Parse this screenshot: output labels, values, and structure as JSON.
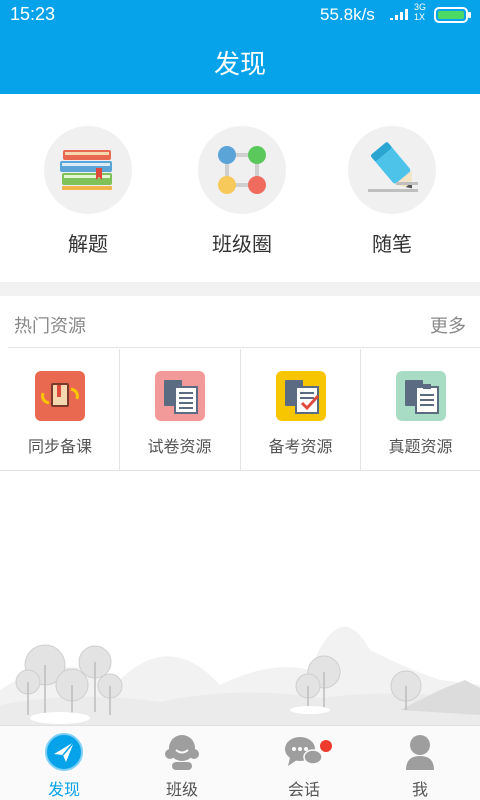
{
  "status_bar": {
    "time": "15:23",
    "net_speed": "55.8k/s",
    "network_top": "3G",
    "network_bottom": "1X",
    "battery_color": "#4cd964"
  },
  "header": {
    "title": "发现"
  },
  "quick_entries": [
    {
      "label": "解题",
      "icon": "books-icon"
    },
    {
      "label": "班级圈",
      "icon": "class-circle-icon"
    },
    {
      "label": "随笔",
      "icon": "pencil-note-icon"
    }
  ],
  "resources": {
    "title": "热门资源",
    "more_label": "更多",
    "items": [
      {
        "label": "同步备课",
        "icon": "sync-lesson-icon",
        "color": "#e8694f"
      },
      {
        "label": "试卷资源",
        "icon": "exam-paper-icon",
        "color": "#f29a9a"
      },
      {
        "label": "备考资源",
        "icon": "exam-prep-icon",
        "color": "#f7c600"
      },
      {
        "label": "真题资源",
        "icon": "real-exam-icon",
        "color": "#a8dcc5"
      }
    ]
  },
  "bottom_nav": [
    {
      "label": "发现",
      "icon": "discover-icon",
      "active": true
    },
    {
      "label": "班级",
      "icon": "class-icon",
      "active": false
    },
    {
      "label": "会话",
      "icon": "chat-icon",
      "active": false
    },
    {
      "label": "我",
      "icon": "profile-icon",
      "active": false
    }
  ],
  "colors": {
    "primary": "#06a3ea",
    "badge": "#ee3b2e"
  }
}
